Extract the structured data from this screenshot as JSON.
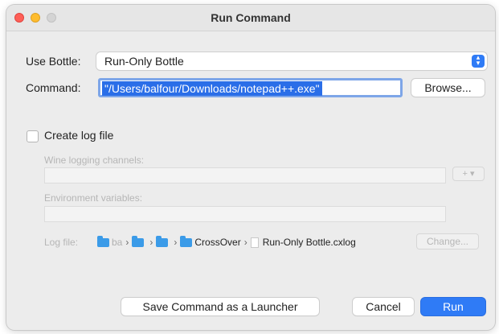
{
  "window": {
    "title": "Run Command"
  },
  "bottle": {
    "label": "Use Bottle:",
    "selected": "Run-Only Bottle"
  },
  "command": {
    "label": "Command:",
    "value": "\"/Users/balfour/Downloads/notepad++.exe\""
  },
  "buttons": {
    "browse": "Browse...",
    "save_launcher": "Save Command as a Launcher",
    "cancel": "Cancel",
    "run": "Run",
    "change": "Change...",
    "add": "+ ▾"
  },
  "log": {
    "checkbox_label": "Create log file",
    "checked": false,
    "channels_label": "Wine logging channels:",
    "channels_value": "",
    "env_label": "Environment variables:",
    "env_value": "",
    "file_label": "Log file:",
    "path": [
      {
        "name": "ba",
        "type": "folder"
      },
      {
        "name": "",
        "type": "folder"
      },
      {
        "name": "",
        "type": "folder"
      },
      {
        "name": "CrossOver",
        "type": "folder"
      },
      {
        "name": "Run-Only Bottle.cxlog",
        "type": "file"
      }
    ]
  },
  "colors": {
    "accent": "#2f7bf6",
    "selection": "#2a6ee8"
  }
}
